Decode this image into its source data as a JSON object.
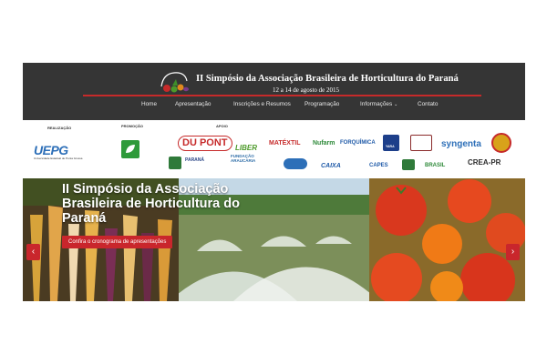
{
  "header": {
    "title": "II Simpósio da Associação Brasileira de Horticultura do Paraná",
    "dates": "12 a 14 de agosto de 2015"
  },
  "nav": {
    "items": [
      "Home",
      "Apresentação",
      "Inscrições e Resumos",
      "Programação",
      "Informações",
      "Contato"
    ]
  },
  "sponsors": {
    "realizacao_label": "REALIZAÇÃO",
    "promocao_label": "PROMOÇÃO",
    "apoio_label": "APOIO",
    "logos": {
      "uepg": "UEPG",
      "uepg_sub": "Universidade Estadual de Ponta Grossa",
      "dupont": "DU PONT",
      "liber": "LIBER",
      "matexil": "MATÉXTIL",
      "nufarm": "Nufarm",
      "forquimica": "FORQUÍMICA",
      "yara": "YARA",
      "syngenta": "syngenta",
      "parana": "PARANÁ",
      "fundacao": "FUNDAÇÃO ARAUCÁRIA",
      "caixa": "CAIXA",
      "capes": "CAPES",
      "brasil": "BRASIL",
      "crea": "CREA-PR"
    }
  },
  "slider": {
    "title": "II Simpósio da Associação Brasileira de Horticultura do Paraná",
    "cta_label": "Confira o cronograma de apresentações",
    "prev_label": "‹",
    "next_label": "›"
  },
  "colors": {
    "header_bg": "#353535",
    "accent_red": "#c9262c",
    "divider_red": "#c62a2a"
  }
}
